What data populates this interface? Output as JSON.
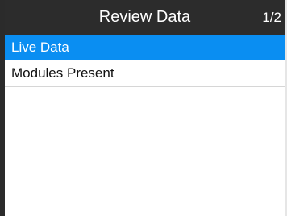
{
  "header": {
    "title": "Review Data",
    "page": "1/2"
  },
  "menu": {
    "items": [
      {
        "label": "Live Data",
        "selected": true
      },
      {
        "label": "Modules Present",
        "selected": false
      }
    ]
  },
  "colors": {
    "title_bar": "#2c2c2c",
    "selection": "#0a8ef2",
    "background": "#ffffff"
  }
}
